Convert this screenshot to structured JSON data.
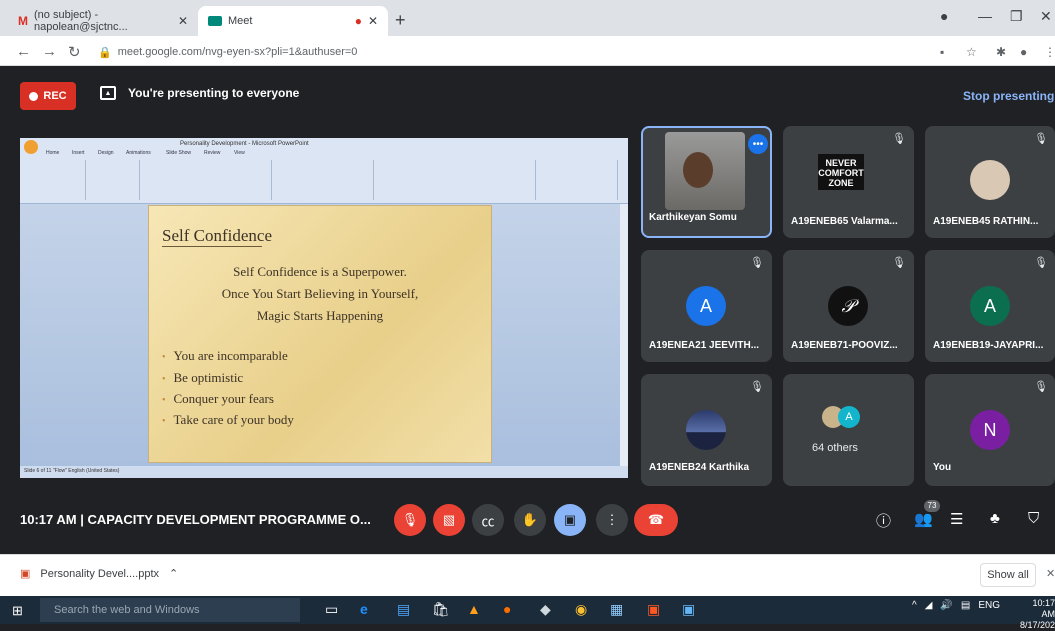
{
  "browser": {
    "tabs": [
      {
        "title": "(no subject) - napolean@sjctnc...",
        "icon": "gmail-icon"
      },
      {
        "title": "Meet",
        "icon": "meet-icon",
        "recording": true
      }
    ],
    "url": "meet.google.com/nvg-eyen-sx?pli=1&authuser=0"
  },
  "meet": {
    "rec_label": "REC",
    "presenting_text": "You're presenting to everyone",
    "stop_label": "Stop presenting",
    "meeting_time": "10:17 AM",
    "meeting_title": "CAPACITY DEVELOPMENT PROGRAMME O...",
    "people_count": "73",
    "others_label": "64 others"
  },
  "presentation": {
    "window_title": "Personality Development - Microsoft PowerPoint",
    "ribbon_tabs": [
      "Home",
      "Insert",
      "Design",
      "Animations",
      "Slide Show",
      "Review",
      "View"
    ],
    "slide_title": "Self Confidence",
    "slide_center": [
      "Self Confidence is a Superpower.",
      "Once You Start Believing in Yourself,",
      "Magic Starts Happening"
    ],
    "slide_bullets": [
      "You are incomparable",
      "Be optimistic",
      "Conquer your fears",
      "Take care of your body"
    ],
    "status_text": "Slide 6 of 11   \"Flow\"   English (United States)"
  },
  "participants": [
    {
      "name": "Karthikeyan Somu",
      "type": "video"
    },
    {
      "name": "A19ENEB65 Valarma...",
      "type": "image",
      "image_text": "NEVER COMFORT ZONE"
    },
    {
      "name": "A19ENEB45 RATHIN...",
      "type": "photo"
    },
    {
      "name": "A19ENEA21 JEEVITH...",
      "type": "letter",
      "letter": "A",
      "color": "#1a73e8"
    },
    {
      "name": "A19ENEB71-POOVIZ...",
      "type": "logo"
    },
    {
      "name": "A19ENEB19-JAYAPRI...",
      "type": "letter",
      "letter": "A",
      "color": "#0b6e4f"
    },
    {
      "name": "A19ENEB24 Karthika",
      "type": "landscape"
    },
    {
      "name": "",
      "type": "others"
    },
    {
      "name": "You",
      "type": "letter",
      "letter": "N",
      "color": "#7b1fa2"
    }
  ],
  "download": {
    "file": "Personality Devel....pptx",
    "show_all": "Show all"
  },
  "taskbar": {
    "search_placeholder": "Search the web and Windows",
    "lang": "ENG",
    "time": "10:17 AM",
    "date": "8/17/202"
  }
}
